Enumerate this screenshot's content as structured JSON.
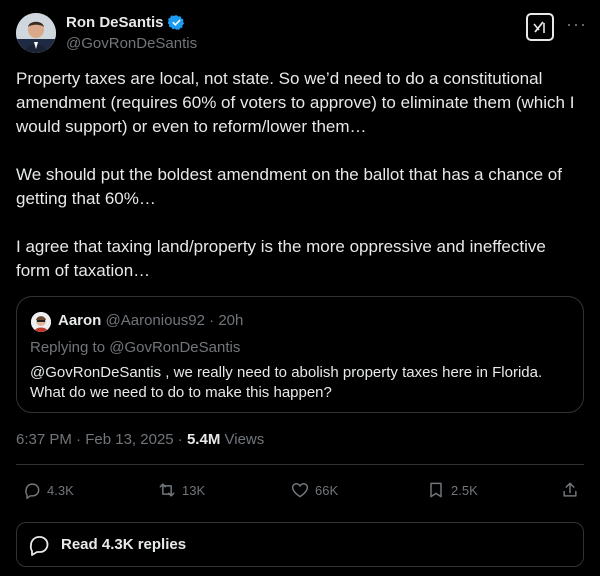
{
  "author": {
    "name": "Ron DeSantis",
    "handle": "@GovRonDeSantis",
    "verified_icon": "verified-badge-icon"
  },
  "post": {
    "paragraphs": [
      "Property taxes are local, not state.  So we’d need to do a constitutional amendment (requires 60% of voters to approve) to eliminate them (which I would support) or even to reform/lower them…",
      "We should put the boldest amendment on the ballot that has a chance of getting that 60%…",
      "I agree that taxing land/property is the more oppressive and ineffective form of taxation…"
    ]
  },
  "quote": {
    "name": "Aaron",
    "handle": "@Aaronious92",
    "time": "20h",
    "replying_to": "Replying to @GovRonDeSantis",
    "text": "@GovRonDeSantis , we really need to abolish property taxes here in Florida. What do we need to do to make this happen?"
  },
  "meta": {
    "time": "6:37 PM",
    "date": "Feb 13, 2025",
    "views_count": "5.4M",
    "views_label": "Views"
  },
  "actions": {
    "replies": "4.3K",
    "reposts": "13K",
    "likes": "66K",
    "bookmarks": "2.5K"
  },
  "read_replies": "Read 4.3K replies",
  "colors": {
    "background": "#000000",
    "text": "#e7e9ea",
    "secondary": "#71767b",
    "border": "#2f3336",
    "verified": "#1d9bf0"
  }
}
